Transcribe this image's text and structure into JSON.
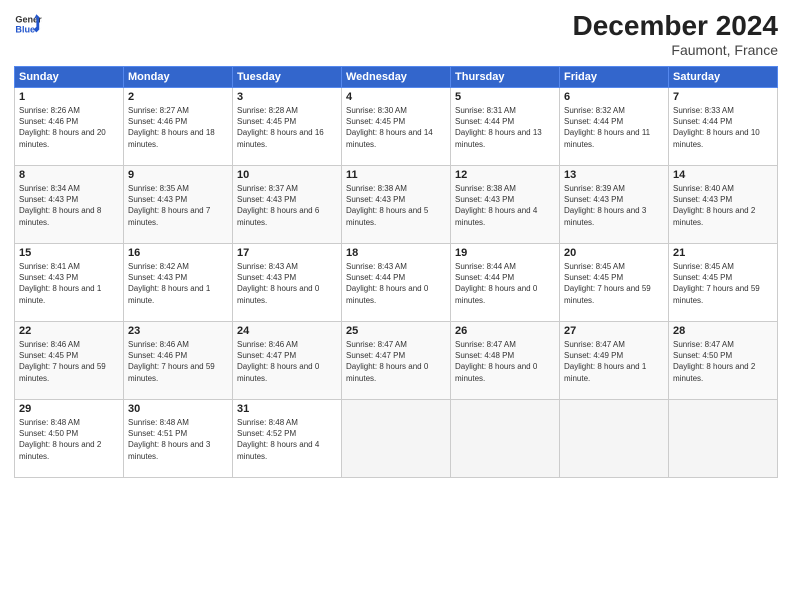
{
  "header": {
    "logo_general": "General",
    "logo_blue": "Blue",
    "title": "December 2024",
    "location": "Faumont, France"
  },
  "days_of_week": [
    "Sunday",
    "Monday",
    "Tuesday",
    "Wednesday",
    "Thursday",
    "Friday",
    "Saturday"
  ],
  "weeks": [
    [
      {
        "num": "1",
        "sunrise": "8:26 AM",
        "sunset": "4:46 PM",
        "daylight": "8 hours and 20 minutes."
      },
      {
        "num": "2",
        "sunrise": "8:27 AM",
        "sunset": "4:46 PM",
        "daylight": "8 hours and 18 minutes."
      },
      {
        "num": "3",
        "sunrise": "8:28 AM",
        "sunset": "4:45 PM",
        "daylight": "8 hours and 16 minutes."
      },
      {
        "num": "4",
        "sunrise": "8:30 AM",
        "sunset": "4:45 PM",
        "daylight": "8 hours and 14 minutes."
      },
      {
        "num": "5",
        "sunrise": "8:31 AM",
        "sunset": "4:44 PM",
        "daylight": "8 hours and 13 minutes."
      },
      {
        "num": "6",
        "sunrise": "8:32 AM",
        "sunset": "4:44 PM",
        "daylight": "8 hours and 11 minutes."
      },
      {
        "num": "7",
        "sunrise": "8:33 AM",
        "sunset": "4:44 PM",
        "daylight": "8 hours and 10 minutes."
      }
    ],
    [
      {
        "num": "8",
        "sunrise": "8:34 AM",
        "sunset": "4:43 PM",
        "daylight": "8 hours and 8 minutes."
      },
      {
        "num": "9",
        "sunrise": "8:35 AM",
        "sunset": "4:43 PM",
        "daylight": "8 hours and 7 minutes."
      },
      {
        "num": "10",
        "sunrise": "8:37 AM",
        "sunset": "4:43 PM",
        "daylight": "8 hours and 6 minutes."
      },
      {
        "num": "11",
        "sunrise": "8:38 AM",
        "sunset": "4:43 PM",
        "daylight": "8 hours and 5 minutes."
      },
      {
        "num": "12",
        "sunrise": "8:38 AM",
        "sunset": "4:43 PM",
        "daylight": "8 hours and 4 minutes."
      },
      {
        "num": "13",
        "sunrise": "8:39 AM",
        "sunset": "4:43 PM",
        "daylight": "8 hours and 3 minutes."
      },
      {
        "num": "14",
        "sunrise": "8:40 AM",
        "sunset": "4:43 PM",
        "daylight": "8 hours and 2 minutes."
      }
    ],
    [
      {
        "num": "15",
        "sunrise": "8:41 AM",
        "sunset": "4:43 PM",
        "daylight": "8 hours and 1 minute."
      },
      {
        "num": "16",
        "sunrise": "8:42 AM",
        "sunset": "4:43 PM",
        "daylight": "8 hours and 1 minute."
      },
      {
        "num": "17",
        "sunrise": "8:43 AM",
        "sunset": "4:43 PM",
        "daylight": "8 hours and 0 minutes."
      },
      {
        "num": "18",
        "sunrise": "8:43 AM",
        "sunset": "4:44 PM",
        "daylight": "8 hours and 0 minutes."
      },
      {
        "num": "19",
        "sunrise": "8:44 AM",
        "sunset": "4:44 PM",
        "daylight": "8 hours and 0 minutes."
      },
      {
        "num": "20",
        "sunrise": "8:45 AM",
        "sunset": "4:45 PM",
        "daylight": "7 hours and 59 minutes."
      },
      {
        "num": "21",
        "sunrise": "8:45 AM",
        "sunset": "4:45 PM",
        "daylight": "7 hours and 59 minutes."
      }
    ],
    [
      {
        "num": "22",
        "sunrise": "8:46 AM",
        "sunset": "4:45 PM",
        "daylight": "7 hours and 59 minutes."
      },
      {
        "num": "23",
        "sunrise": "8:46 AM",
        "sunset": "4:46 PM",
        "daylight": "7 hours and 59 minutes."
      },
      {
        "num": "24",
        "sunrise": "8:46 AM",
        "sunset": "4:47 PM",
        "daylight": "8 hours and 0 minutes."
      },
      {
        "num": "25",
        "sunrise": "8:47 AM",
        "sunset": "4:47 PM",
        "daylight": "8 hours and 0 minutes."
      },
      {
        "num": "26",
        "sunrise": "8:47 AM",
        "sunset": "4:48 PM",
        "daylight": "8 hours and 0 minutes."
      },
      {
        "num": "27",
        "sunrise": "8:47 AM",
        "sunset": "4:49 PM",
        "daylight": "8 hours and 1 minute."
      },
      {
        "num": "28",
        "sunrise": "8:47 AM",
        "sunset": "4:50 PM",
        "daylight": "8 hours and 2 minutes."
      }
    ],
    [
      {
        "num": "29",
        "sunrise": "8:48 AM",
        "sunset": "4:50 PM",
        "daylight": "8 hours and 2 minutes."
      },
      {
        "num": "30",
        "sunrise": "8:48 AM",
        "sunset": "4:51 PM",
        "daylight": "8 hours and 3 minutes."
      },
      {
        "num": "31",
        "sunrise": "8:48 AM",
        "sunset": "4:52 PM",
        "daylight": "8 hours and 4 minutes."
      },
      null,
      null,
      null,
      null
    ]
  ]
}
